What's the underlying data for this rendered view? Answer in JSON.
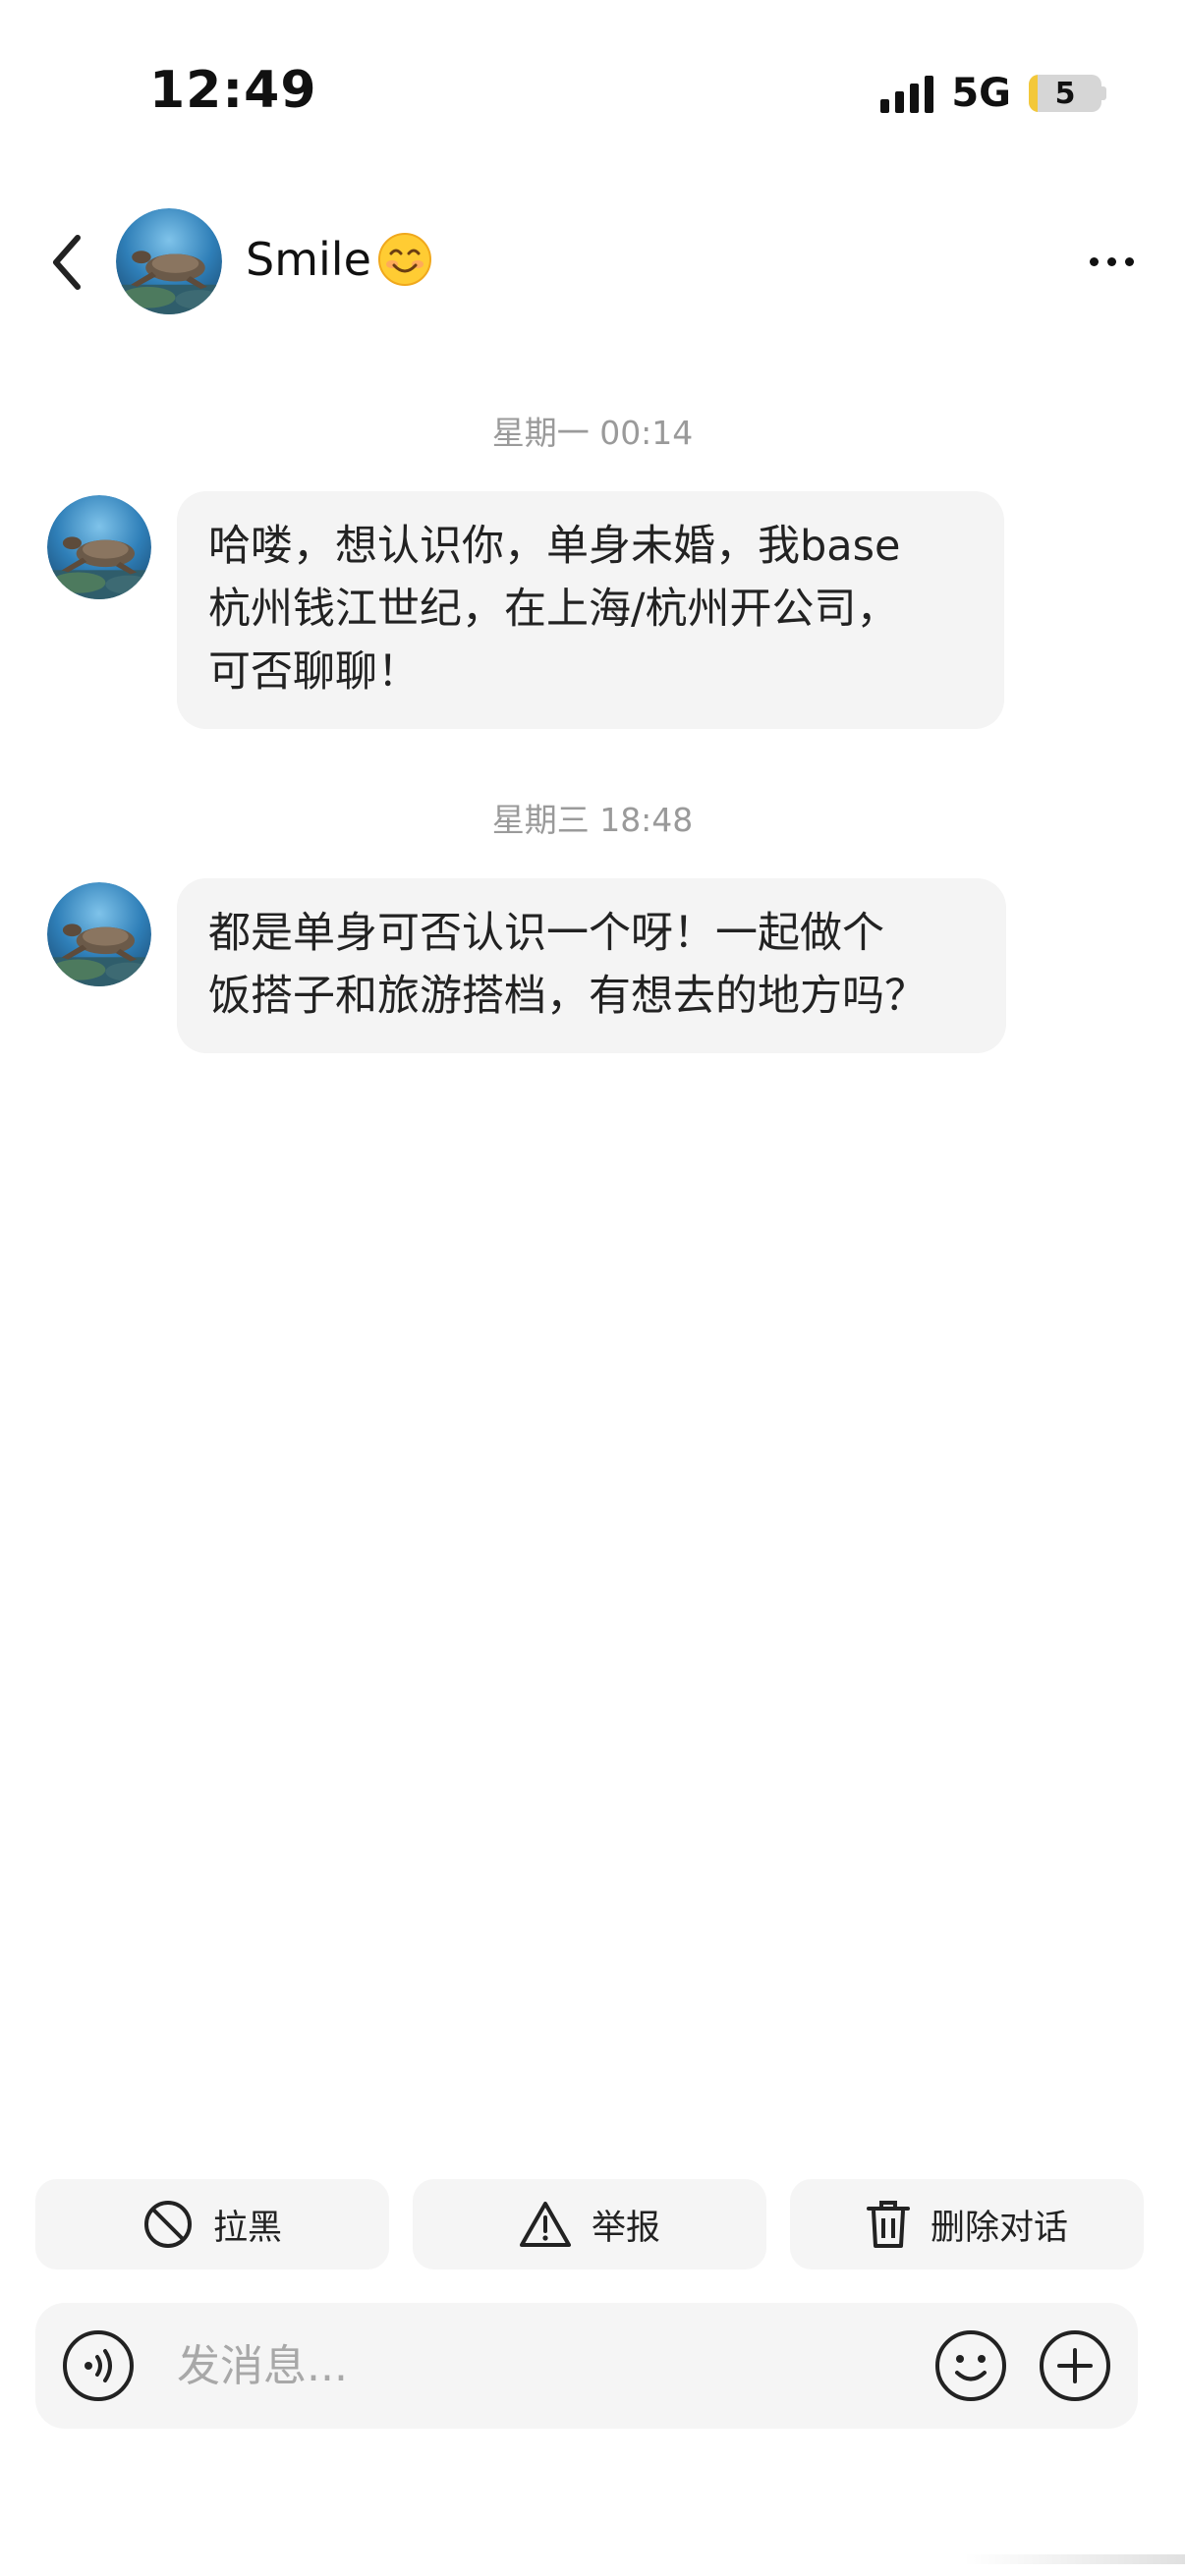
{
  "status_bar": {
    "time": "12:49",
    "network": "5G",
    "battery_level": "5",
    "battery_fraction": 0.12,
    "battery_fill_color": "#f3c83a"
  },
  "header": {
    "back_icon": "chevron-left-icon",
    "contact_name": "Smile",
    "name_emoji": "smiling-face-emoji",
    "more_icon": "ellipsis-icon"
  },
  "messages": [
    {
      "timestamp": "星期一 00:14",
      "lines": [
        "哈喽，想认识你，单身未婚，我base",
        "杭州钱江世纪，在上海/杭州开公司，",
        "可否聊聊！"
      ]
    },
    {
      "timestamp": "星期三 18:48",
      "lines": [
        "都是单身可否认识一个呀！一起做个",
        "饭搭子和旅游搭档，有想去的地方吗？"
      ]
    }
  ],
  "actions": {
    "block_label": "拉黑",
    "report_label": "举报",
    "delete_label": "删除对话"
  },
  "input": {
    "placeholder": "发消息...",
    "value": ""
  },
  "colors": {
    "bubble_bg": "#f4f4f4",
    "timestamp_text": "#9a9a9a",
    "button_bg": "#f5f5f5"
  }
}
